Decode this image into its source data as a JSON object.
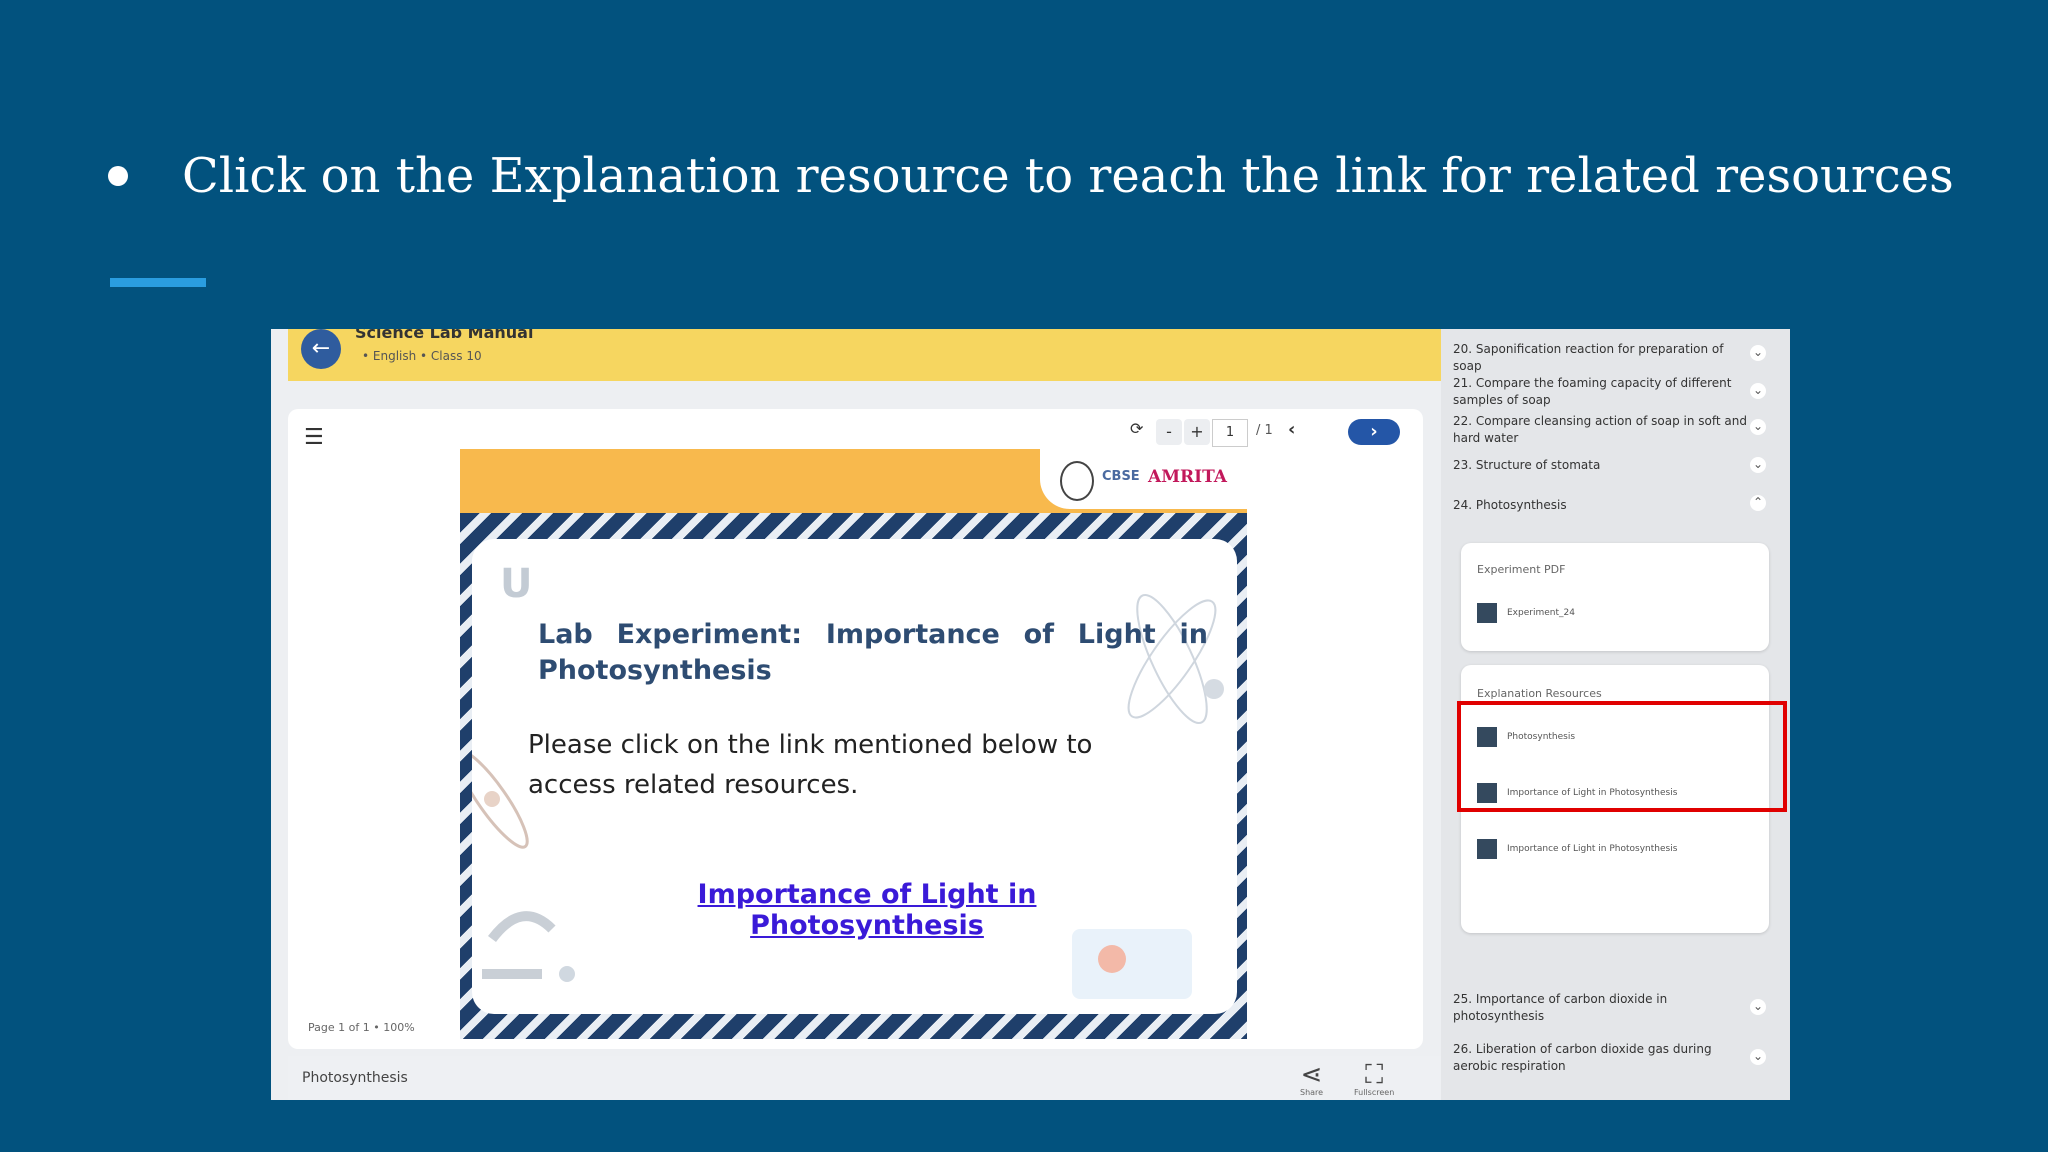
{
  "slide": {
    "bullet_text": "Click on the Explanation resource to reach the link for related resources"
  },
  "app": {
    "header": {
      "title": "Science Lab Manual",
      "meta": "• English • Class 10"
    },
    "toolbar": {
      "page_value": "1",
      "page_total": "/ 1"
    },
    "page_status": "Page 1 of 1 • 100%",
    "document": {
      "logo_cbse": "CBSE",
      "logo_amrita": "AMRITA",
      "corner_letter": "U",
      "title_line1": "Lab Experiment: Importance of Light in",
      "title_line2": "Photosynthesis",
      "body": "Please click on the link mentioned below to access related resources.",
      "link": "Importance of Light in Photosynthesis"
    },
    "footer": {
      "label": "Photosynthesis",
      "share": "Share",
      "fullscreen": "Fullscreen"
    }
  },
  "sidebar": {
    "items": [
      {
        "label": "20. Saponification reaction for preparation of soap"
      },
      {
        "label": "21. Compare the foaming capacity of different samples of soap"
      },
      {
        "label": "22. Compare cleansing action of soap in soft and hard water"
      },
      {
        "label": "23. Structure of stomata"
      },
      {
        "label": "24. Photosynthesis"
      },
      {
        "label": "25. Importance of carbon dioxide in photosynthesis"
      },
      {
        "label": "26. Liberation of carbon dioxide gas during aerobic respiration"
      }
    ],
    "experiment_pdf": {
      "heading": "Experiment PDF",
      "file": "Experiment_24"
    },
    "explanation": {
      "heading": "Explanation Resources",
      "rows": [
        "Photosynthesis",
        "Importance of Light in Photosynthesis",
        "Importance of Light in Photosynthesis"
      ]
    }
  },
  "colors": {
    "slide_bg": "#02527e",
    "accent": "#2a9de0",
    "highlight": "#e00000",
    "header_bg": "#f6d660"
  }
}
